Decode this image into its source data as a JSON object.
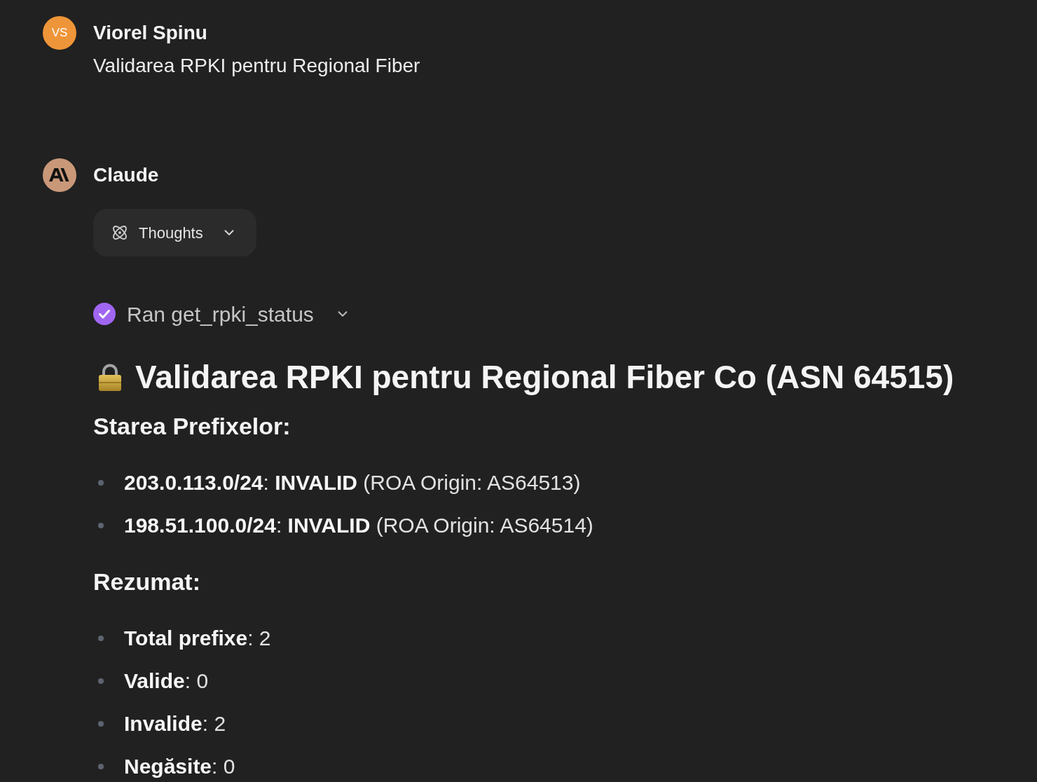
{
  "user_message": {
    "avatar_initials": "VS",
    "author": "Viorel Spinu",
    "text": "Validarea RPKI pentru Regional Fiber"
  },
  "assistant_message": {
    "author": "Claude",
    "thoughts": {
      "label": "Thoughts",
      "expanded": false
    },
    "tool_call": {
      "label": "Ran get_rpki_status",
      "completed": true,
      "expanded": false
    },
    "content": [
      {
        "kind": "title",
        "text": "Validarea RPKI pentru Regional Fiber Co (ASN 64515)"
      },
      {
        "kind": "subheading",
        "text": "Starea Prefixelor:"
      },
      {
        "kind": "list",
        "items": [
          "**203.0.113.0/24**: **INVALID** (ROA Origin: AS64513)",
          "**198.51.100.0/24**: **INVALID** (ROA Origin: AS64514)"
        ]
      },
      {
        "kind": "subheading",
        "text": "Rezumat:"
      },
      {
        "kind": "list",
        "items": [
          "**Total prefixe**: 2",
          "**Valide**: 0",
          "**Invalide**: 2",
          "**Negăsite**: 0"
        ]
      }
    ]
  }
}
